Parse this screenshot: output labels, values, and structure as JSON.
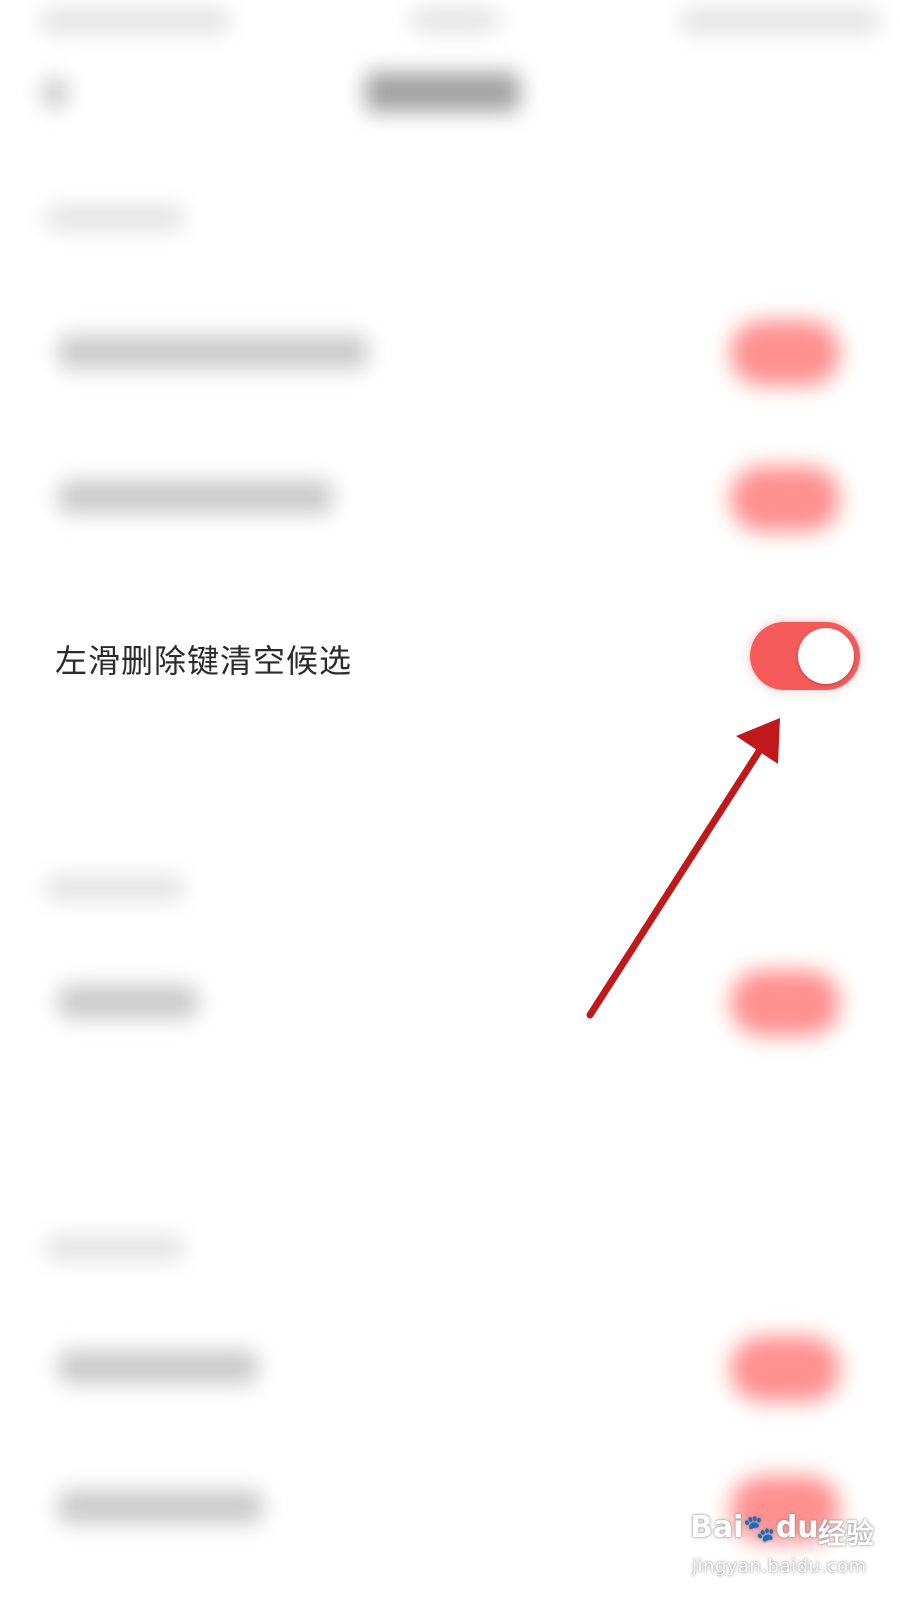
{
  "setting": {
    "label": "左滑删除键清空候选",
    "toggle_on": true
  },
  "colors": {
    "accent": "#f55b5b",
    "arrow": "#c0191b",
    "background": "#ffffff"
  },
  "watermark": {
    "logo_left": "Bai",
    "logo_paw": "🐾",
    "logo_right": "du",
    "product": "经验",
    "url": "jingyan.baidu.com"
  }
}
